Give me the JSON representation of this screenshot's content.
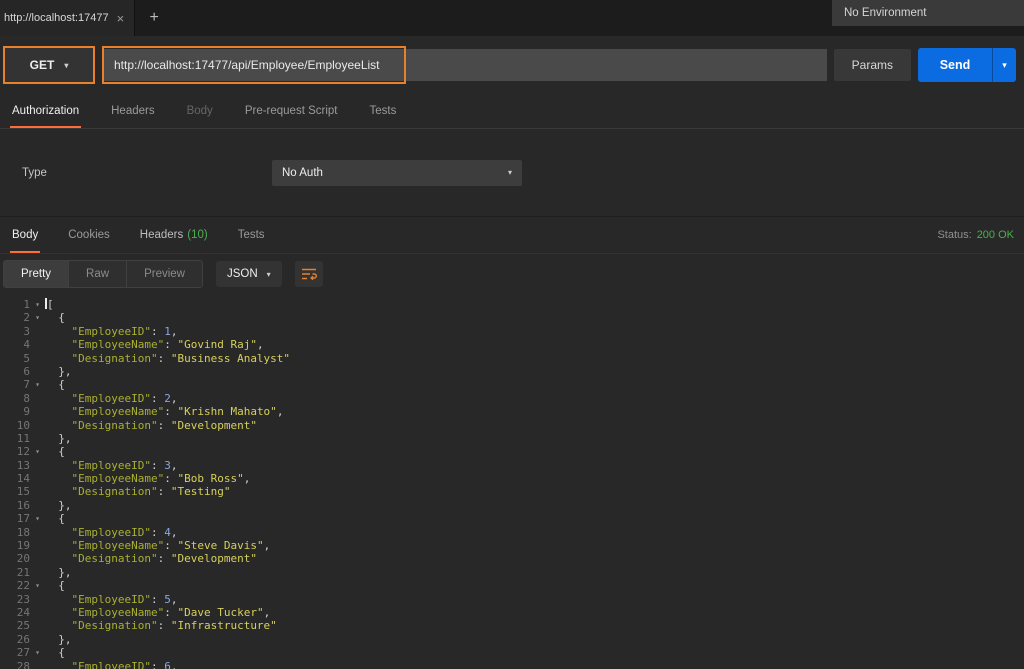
{
  "colors": {
    "accent": "#ff6c37",
    "annotation": "#e8802c",
    "send-blue": "#0a6ce0",
    "status-green": "#4caf50",
    "count-green": "#4caf50",
    "syn-key": "#aab032",
    "syn-string": "#d6d05c",
    "syn-number": "#8ba7dc",
    "syn-punct": "#d0d0d0"
  },
  "tab_bar": {
    "tab_title": "http://localhost:17477",
    "close_label": "×",
    "new_tab_label": "+",
    "environment_label": "No Environment"
  },
  "request": {
    "method": "GET",
    "url": "http://localhost:17477/api/Employee/EmployeeList",
    "params_label": "Params",
    "send_label": "Send"
  },
  "request_tabs": [
    {
      "label": "Authorization"
    },
    {
      "label": "Headers"
    },
    {
      "label": "Body"
    },
    {
      "label": "Pre-request Script"
    },
    {
      "label": "Tests"
    }
  ],
  "authorization": {
    "type_label": "Type",
    "type_value": "No Auth"
  },
  "response": {
    "tabs": [
      {
        "label": "Body"
      },
      {
        "label": "Cookies"
      },
      {
        "label": "Headers",
        "count": "(10)"
      },
      {
        "label": "Tests"
      }
    ],
    "status_label": "Status:",
    "status_value": "200 OK",
    "view_modes": [
      "Pretty",
      "Raw",
      "Preview"
    ],
    "format_value": "JSON"
  },
  "response_body": {
    "first_line_token": "[",
    "employees": [
      {
        "EmployeeID": 1,
        "EmployeeName": "Govind Raj",
        "Designation": "Business Analyst"
      },
      {
        "EmployeeID": 2,
        "EmployeeName": "Krishn Mahato",
        "Designation": "Development"
      },
      {
        "EmployeeID": 3,
        "EmployeeName": "Bob Ross",
        "Designation": "Testing"
      },
      {
        "EmployeeID": 4,
        "EmployeeName": "Steve Davis",
        "Designation": "Development"
      },
      {
        "EmployeeID": 5,
        "EmployeeName": "Dave Tucker",
        "Designation": "Infrastructure"
      }
    ],
    "partial_last_visible": {
      "EmployeeID": 6
    }
  }
}
